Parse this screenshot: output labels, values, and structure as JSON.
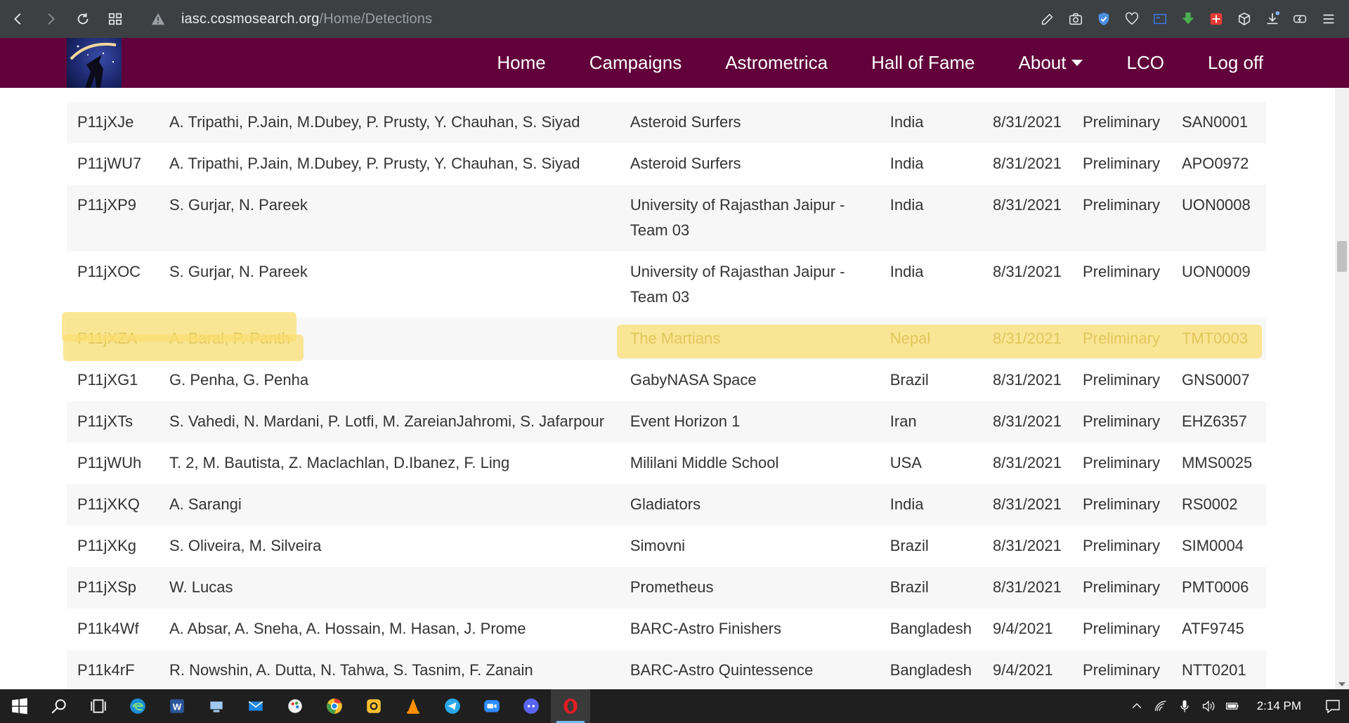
{
  "browser": {
    "url_host": "iasc.cosmosearch.org",
    "url_path": "/Home/Detections",
    "extension_icons": [
      "edit-icon",
      "camera-icon",
      "shield-icon",
      "heart-icon",
      "tab-icon",
      "download-arrow-icon",
      "addon-red-icon",
      "cube-icon",
      "downloads-icon",
      "battery-icon",
      "menu-icon"
    ]
  },
  "site": {
    "nav": [
      {
        "label": "Home"
      },
      {
        "label": "Campaigns"
      },
      {
        "label": "Astrometrica"
      },
      {
        "label": "Hall of Fame"
      },
      {
        "label": "About"
      },
      {
        "label": "LCO"
      },
      {
        "label": "Log off"
      }
    ]
  },
  "detections": [
    {
      "id": "P11jXJe",
      "observers": "A. Tripathi, P.Jain, M.Dubey, P. Prusty, Y. Chauhan, S. Siyad",
      "team": "Asteroid Surfers",
      "country": "India",
      "date": "8/31/2021",
      "status": "Preliminary",
      "code": "SAN0001"
    },
    {
      "id": "P11jWU7",
      "observers": "A. Tripathi, P.Jain, M.Dubey, P. Prusty, Y. Chauhan, S. Siyad",
      "team": "Asteroid Surfers",
      "country": "India",
      "date": "8/31/2021",
      "status": "Preliminary",
      "code": "APO0972"
    },
    {
      "id": "P11jXP9",
      "observers": "S. Gurjar, N. Pareek",
      "team": "University of Rajasthan Jaipur - Team 03",
      "country": "India",
      "date": "8/31/2021",
      "status": "Preliminary",
      "code": "UON0008"
    },
    {
      "id": "P11jXOC",
      "observers": "S. Gurjar, N. Pareek",
      "team": "University of Rajasthan Jaipur - Team 03",
      "country": "India",
      "date": "8/31/2021",
      "status": "Preliminary",
      "code": "UON0009"
    },
    {
      "id": "P11jXZA",
      "observers": "A. Baral, P. Panth",
      "team": "The Martians",
      "country": "Nepal",
      "date": "8/31/2021",
      "status": "Preliminary",
      "code": "TMT0003",
      "highlighted": true
    },
    {
      "id": "P11jXG1",
      "observers": "G. Penha, G. Penha",
      "team": "GabyNASA Space",
      "country": "Brazil",
      "date": "8/31/2021",
      "status": "Preliminary",
      "code": "GNS0007"
    },
    {
      "id": "P11jXTs",
      "observers": "S. Vahedi, N. Mardani, P. Lotfi, M. ZareianJahromi, S. Jafarpour",
      "team": "Event Horizon 1",
      "country": "Iran",
      "date": "8/31/2021",
      "status": "Preliminary",
      "code": "EHZ6357"
    },
    {
      "id": "P11jWUh",
      "observers": "T. 2, M. Bautista, Z. Maclachlan, D.Ibanez, F. Ling",
      "team": "Mililani Middle School",
      "country": "USA",
      "date": "8/31/2021",
      "status": "Preliminary",
      "code": "MMS0025"
    },
    {
      "id": "P11jXKQ",
      "observers": "A. Sarangi",
      "team": "Gladiators",
      "country": "India",
      "date": "8/31/2021",
      "status": "Preliminary",
      "code": "RS0002"
    },
    {
      "id": "P11jXKg",
      "observers": "S. Oliveira, M. Silveira",
      "team": "Simovni",
      "country": "Brazil",
      "date": "8/31/2021",
      "status": "Preliminary",
      "code": "SIM0004"
    },
    {
      "id": "P11jXSp",
      "observers": "W. Lucas",
      "team": "Prometheus",
      "country": "Brazil",
      "date": "8/31/2021",
      "status": "Preliminary",
      "code": "PMT0006"
    },
    {
      "id": "P11k4Wf",
      "observers": "A. Absar, A. Sneha, A. Hossain, M. Hasan, J. Prome",
      "team": "BARC-Astro Finishers",
      "country": "Bangladesh",
      "date": "9/4/2021",
      "status": "Preliminary",
      "code": "ATF9745"
    },
    {
      "id": "P11k4rF",
      "observers": "R. Nowshin, A. Dutta, N. Tahwa, S. Tasnim, F. Zanain",
      "team": "BARC-Astro Quintessence",
      "country": "Bangladesh",
      "date": "9/4/2021",
      "status": "Preliminary",
      "code": "NTT0201"
    }
  ],
  "taskbar": {
    "apps": [
      "windows-start-icon",
      "search-icon",
      "task-view-icon",
      "edge-icon",
      "word-icon",
      "file-explorer-icon",
      "mail-icon",
      "paint-icon",
      "chrome-icon",
      "app-yellow-icon",
      "vlc-icon",
      "telegram-icon",
      "zoom-icon",
      "discord-icon",
      "opera-icon"
    ],
    "clock": "2:14 PM"
  },
  "colors": {
    "browser_bar": "#3c4043",
    "site_header": "#61003a",
    "highlight": "#fade6e",
    "taskbar": "#1f1f1f"
  }
}
